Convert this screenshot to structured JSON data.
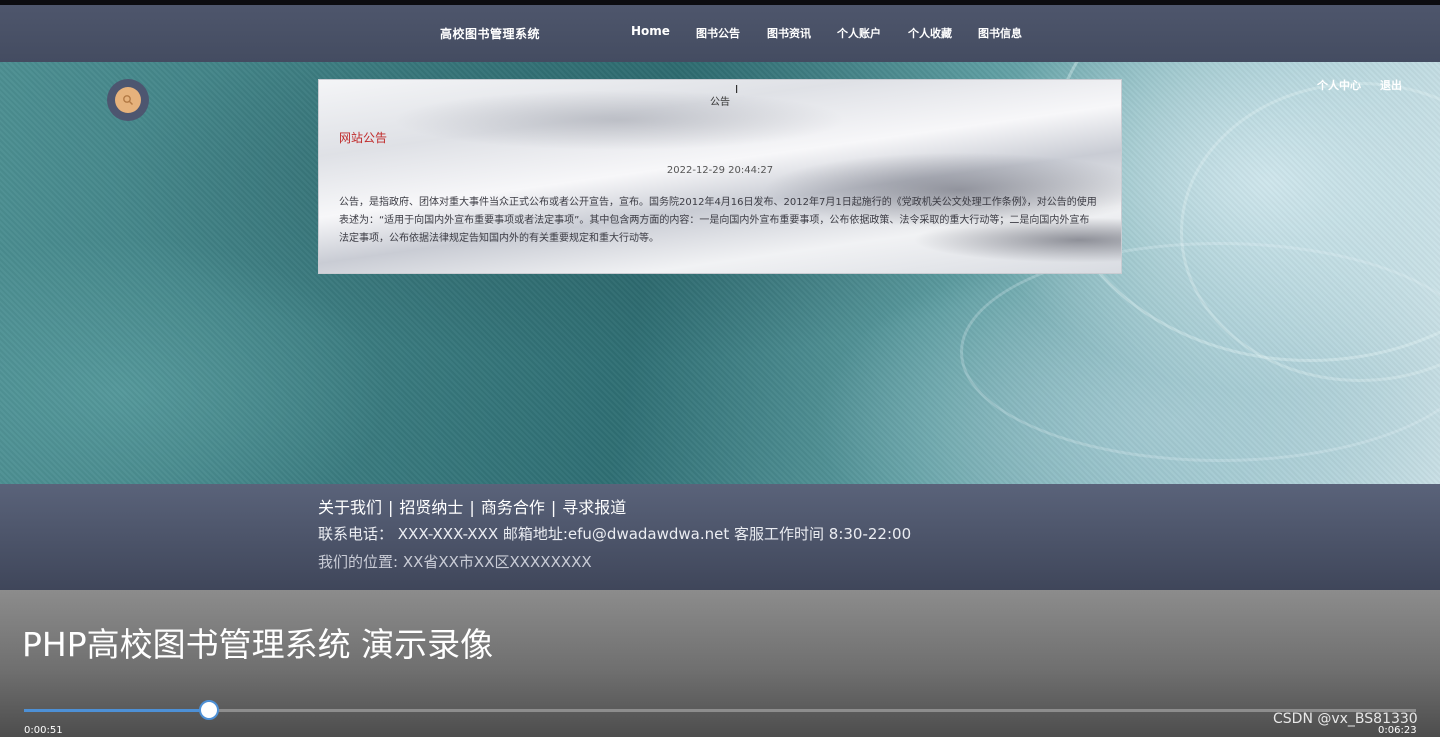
{
  "header": {
    "site_title": "高校图书管理系统",
    "nav": [
      "Home",
      "图书公告",
      "图书资讯",
      "个人账户",
      "个人收藏",
      "图书信息"
    ]
  },
  "user_links": {
    "center": "个人中心",
    "logout": "退出"
  },
  "icons": {
    "search": "search-icon"
  },
  "notice": {
    "heading": "公告",
    "title": "网站公告",
    "date": "2022-12-29 20:44:27",
    "body": "公告，是指政府、团体对重大事件当众正式公布或者公开宣告，宣布。国务院2012年4月16日发布、2012年7月1日起施行的《党政机关公文处理工作条例》，对公告的使用表述为：“适用于向国内外宣布重要事项或者法定事项”。其中包含两方面的内容：一是向国内外宣布重要事项，公布依据政策、法令采取的重大行动等；二是向国内外宣布法定事项，公布依据法律规定告知国内外的有关重要规定和重大行动等。"
  },
  "footer": {
    "links": [
      "关于我们",
      "招贤纳士",
      "商务合作",
      "寻求报道"
    ],
    "contact": "联系电话： XXX-XXX-XXX 邮箱地址:efu@dwadawdwa.net 客服工作时间 8:30-22:00",
    "address": "我们的位置: XX省XX市XX区XXXXXXXX"
  },
  "player": {
    "title": "PHP高校图书管理系统 演示录像",
    "current_time": "0:00:51",
    "total_time": "0:06:23",
    "progress": 0.1332,
    "watermark": "CSDN @vx_BS81330"
  },
  "colors": {
    "navbar": "#4a5268",
    "notice_title": "#c02a2a",
    "progress": "#4d90d6",
    "search_inner": "#e6b27c"
  }
}
